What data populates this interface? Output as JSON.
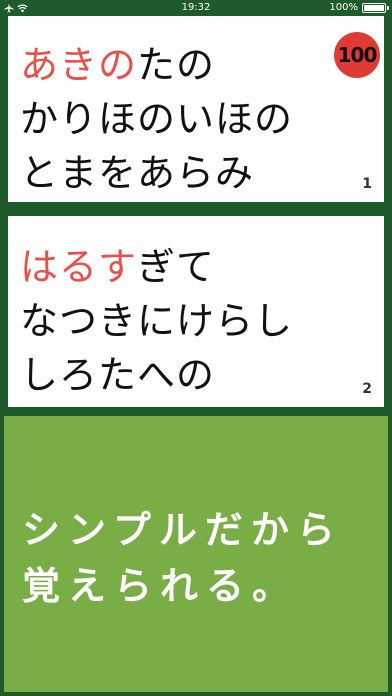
{
  "status_bar": {
    "time": "19:32",
    "battery_text": "100%",
    "battery_level": 1.0
  },
  "cards": [
    {
      "lines": [
        {
          "highlight": "あきの",
          "rest": "たの"
        },
        {
          "highlight": "",
          "rest": "かりほのいほの"
        },
        {
          "highlight": "",
          "rest": "とまをあらみ"
        }
      ],
      "number": "1",
      "score": "100"
    },
    {
      "lines": [
        {
          "highlight": "はるす",
          "rest": "ぎて"
        },
        {
          "highlight": "",
          "rest": "なつきにけらし"
        },
        {
          "highlight": "",
          "rest": "しろたへの"
        }
      ],
      "number": "2"
    }
  ],
  "promo": {
    "line1": "シンプルだから",
    "line2": "覚えられる。"
  },
  "colors": {
    "background": "#1f5a2b",
    "highlight": "#e8504b",
    "badge": "#e03a34",
    "promo": "#79ad45"
  },
  "icons": [
    "airplane-icon",
    "wifi-icon",
    "battery-icon"
  ]
}
